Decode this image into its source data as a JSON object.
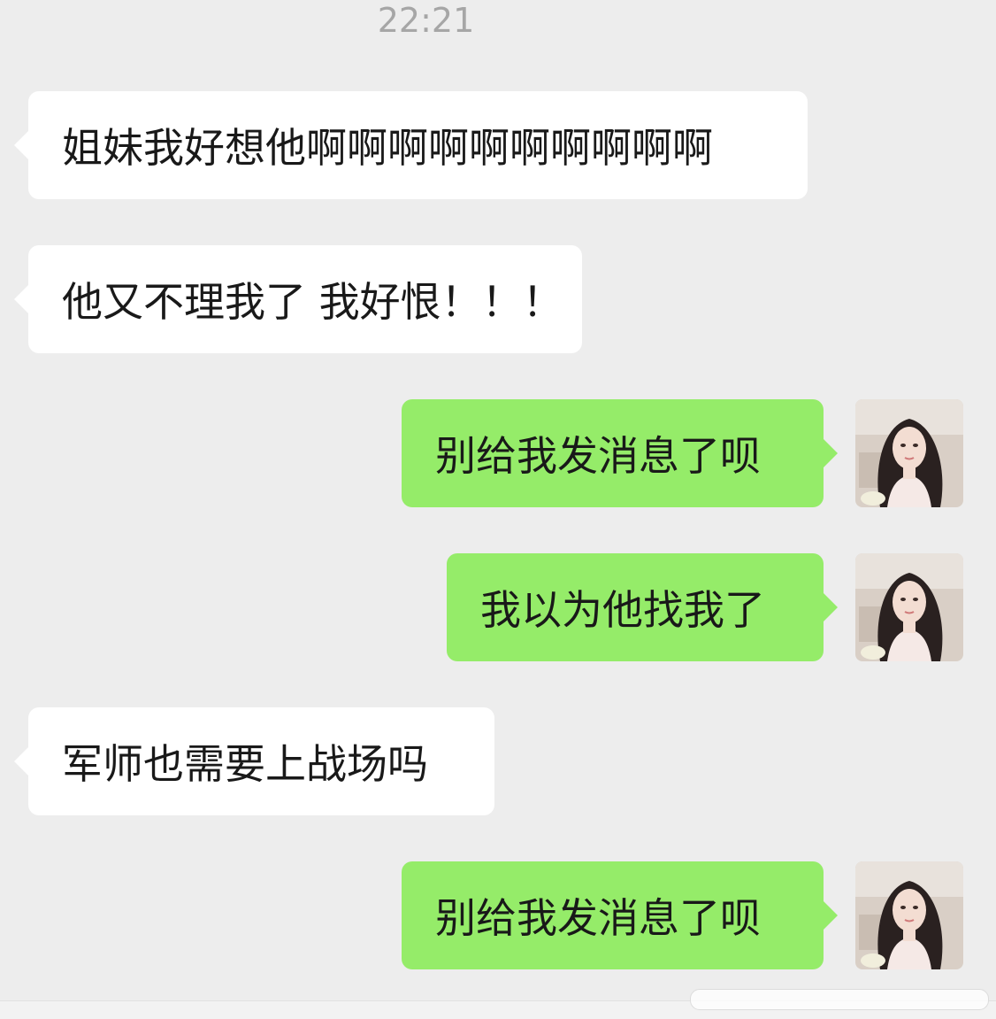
{
  "chat": {
    "timestamp": "22:21",
    "messages": [
      {
        "side": "in",
        "text": "姐妹我好想他啊啊啊啊啊啊啊啊啊啊"
      },
      {
        "side": "in",
        "text": "他又不理我了 我好恨！！！"
      },
      {
        "side": "out",
        "text": "别给我发消息了呗",
        "avatar": "user-avatar"
      },
      {
        "side": "out",
        "text": "我以为他找我了",
        "avatar": "user-avatar"
      },
      {
        "side": "in",
        "text": "军师也需要上战场吗"
      },
      {
        "side": "out",
        "text": "别给我发消息了呗",
        "avatar": "user-avatar"
      }
    ]
  },
  "colors": {
    "background": "#ededed",
    "incoming_bubble": "#ffffff",
    "outgoing_bubble": "#95ec69",
    "timestamp_text": "#a6a6a6",
    "message_text": "#191919"
  }
}
